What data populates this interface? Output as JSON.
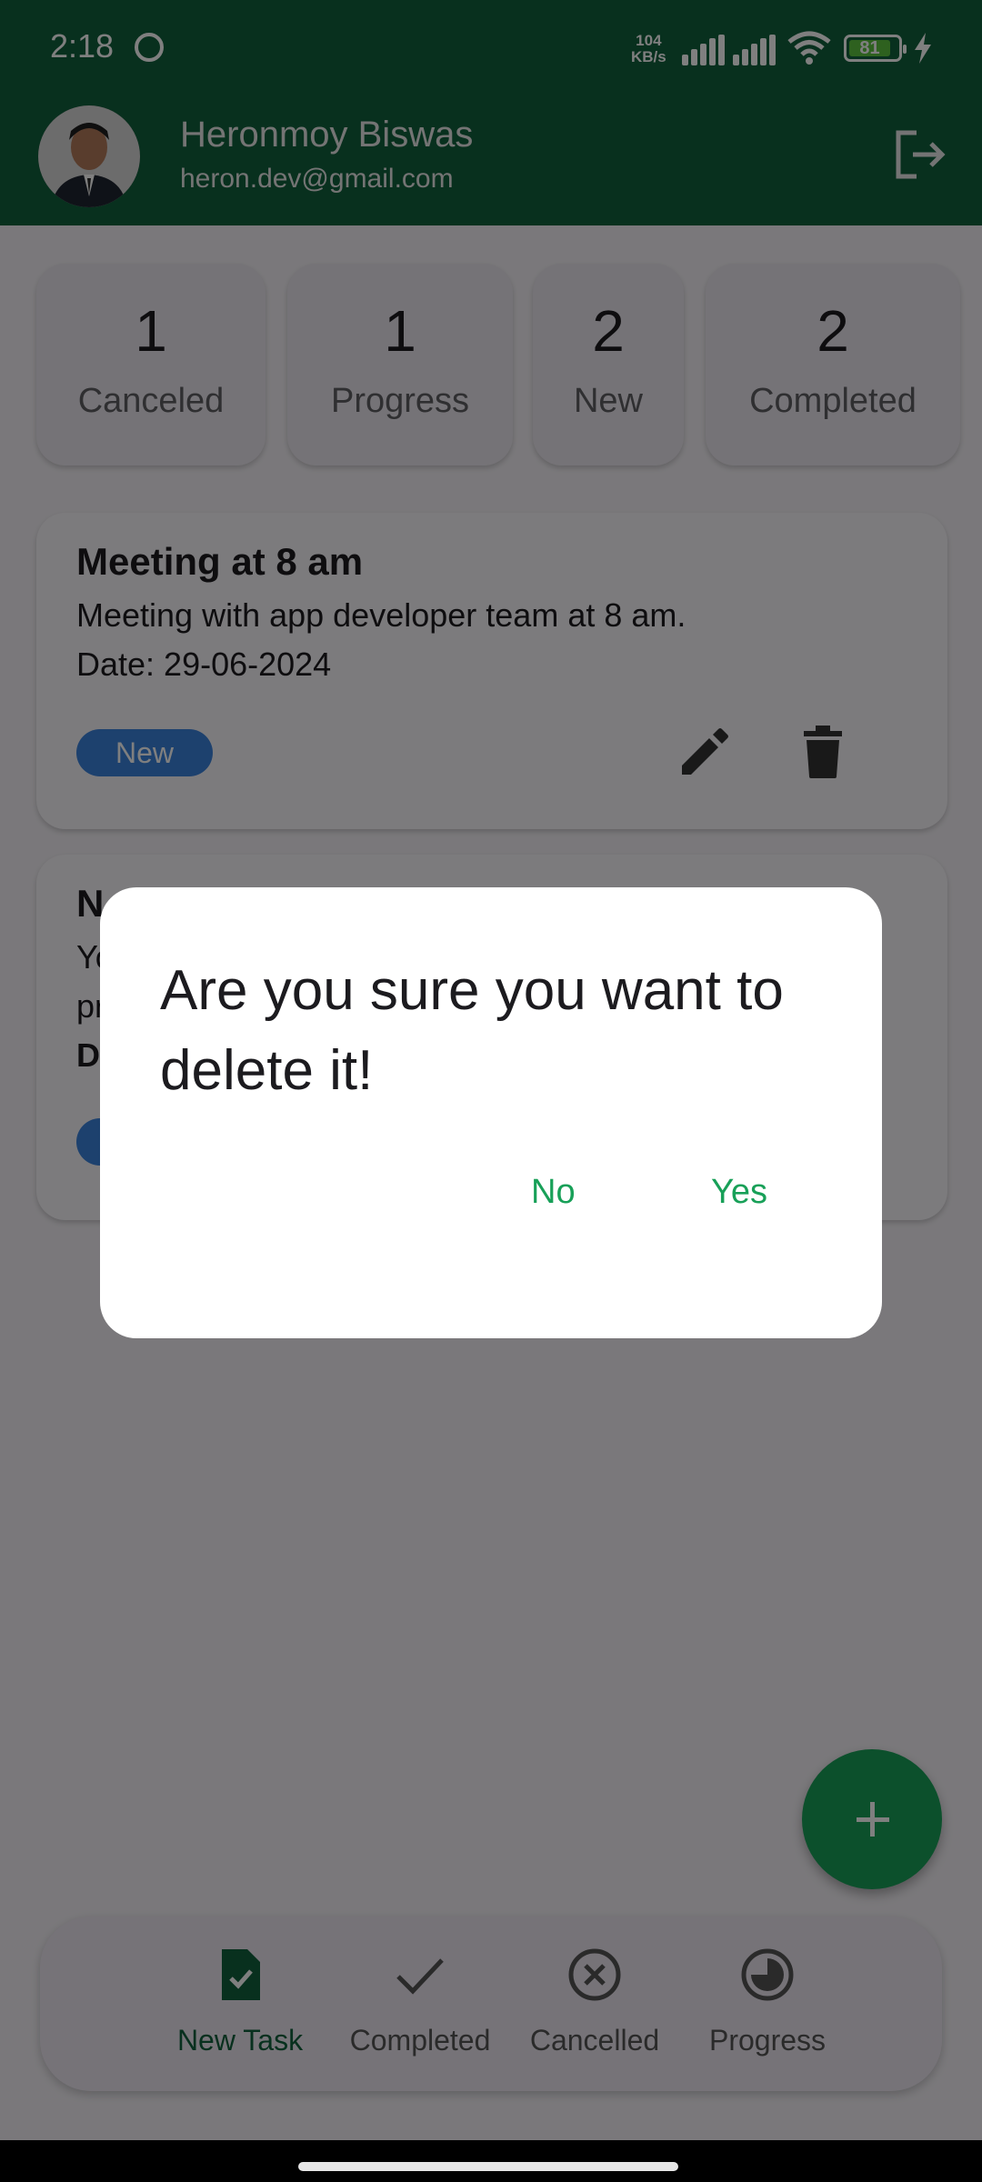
{
  "status_bar": {
    "time": "2:18",
    "net_speed": "104",
    "net_unit": "KB/s",
    "battery": "81"
  },
  "header": {
    "name": "Heronmoy Biswas",
    "email": "heron.dev@gmail.com"
  },
  "summary": [
    {
      "count": "1",
      "label": "Canceled"
    },
    {
      "count": "1",
      "label": "Progress"
    },
    {
      "count": "2",
      "label": "New"
    },
    {
      "count": "2",
      "label": "Completed"
    }
  ],
  "tasks": [
    {
      "title": "Meeting at 8 am",
      "description": "Meeting with app developer team at 8 am.",
      "date": "Date: 29-06-2024",
      "status": "New"
    },
    {
      "title": "N",
      "description": "Yo",
      "description2": "pr",
      "date": "D"
    }
  ],
  "dialog": {
    "message": "Are you sure you want to delete it!",
    "no_label": "No",
    "yes_label": "Yes"
  },
  "nav": [
    {
      "label": "New Task",
      "icon": "task-check-icon",
      "active": true
    },
    {
      "label": "Completed",
      "icon": "check-icon"
    },
    {
      "label": "Cancelled",
      "icon": "cancel-circle-icon"
    },
    {
      "label": "Progress",
      "icon": "progress-icon"
    }
  ],
  "colors": {
    "primary": "#11613c",
    "accent": "#18a058",
    "chip": "#3b82dd"
  }
}
